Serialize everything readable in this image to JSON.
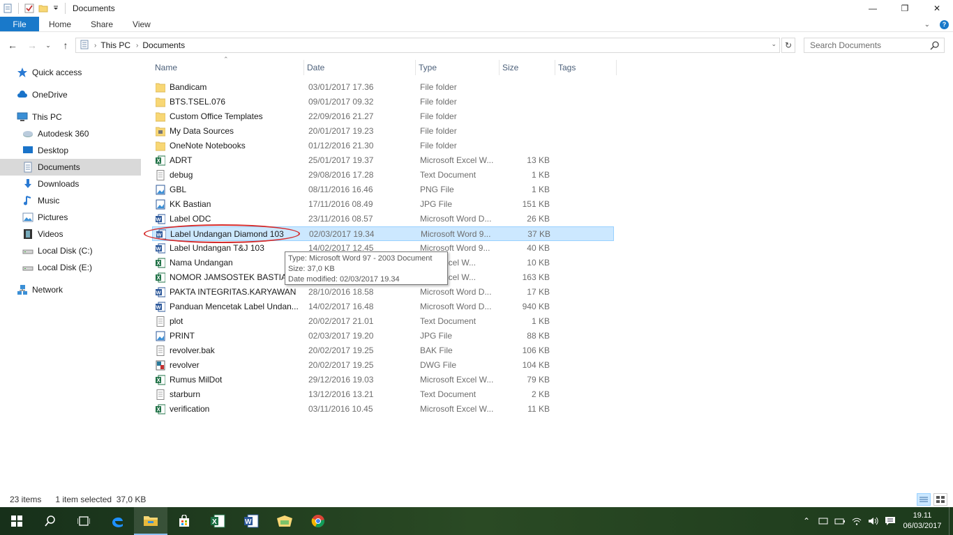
{
  "window": {
    "title": "Documents",
    "minimize": "—",
    "restore": "❐",
    "close": "✕"
  },
  "ribbon": {
    "tabs": [
      "File",
      "Home",
      "Share",
      "View"
    ]
  },
  "address": {
    "crumbs": [
      "This PC",
      "Documents"
    ],
    "search_placeholder": "Search Documents"
  },
  "nav": {
    "items": [
      {
        "label": "Quick access",
        "icon": "star-icon",
        "indent": false
      },
      {
        "label": "OneDrive",
        "icon": "cloud-icon",
        "indent": false
      },
      {
        "label": "This PC",
        "icon": "computer-icon",
        "indent": false
      },
      {
        "label": "Autodesk 360",
        "icon": "cloud-drive-icon",
        "indent": true
      },
      {
        "label": "Desktop",
        "icon": "desktop-icon",
        "indent": true
      },
      {
        "label": "Documents",
        "icon": "documents-icon",
        "indent": true,
        "selected": true
      },
      {
        "label": "Downloads",
        "icon": "download-icon",
        "indent": true
      },
      {
        "label": "Music",
        "icon": "music-icon",
        "indent": true
      },
      {
        "label": "Pictures",
        "icon": "pictures-icon",
        "indent": true
      },
      {
        "label": "Videos",
        "icon": "videos-icon",
        "indent": true
      },
      {
        "label": "Local Disk (C:)",
        "icon": "disk-icon",
        "indent": true
      },
      {
        "label": "Local Disk (E:)",
        "icon": "disk-icon",
        "indent": true
      },
      {
        "label": "Network",
        "icon": "network-icon",
        "indent": false
      }
    ]
  },
  "columns": {
    "name": "Name",
    "date": "Date",
    "type": "Type",
    "size": "Size",
    "tags": "Tags"
  },
  "files": [
    {
      "name": "Bandicam",
      "date": "03/01/2017 17.36",
      "type": "File folder",
      "size": "",
      "icon": "folder"
    },
    {
      "name": "BTS.TSEL.076",
      "date": "09/01/2017 09.32",
      "type": "File folder",
      "size": "",
      "icon": "folder"
    },
    {
      "name": "Custom Office Templates",
      "date": "22/09/2016 21.27",
      "type": "File folder",
      "size": "",
      "icon": "folder"
    },
    {
      "name": "My Data Sources",
      "date": "20/01/2017 19.23",
      "type": "File folder",
      "size": "",
      "icon": "folder-special"
    },
    {
      "name": "OneNote Notebooks",
      "date": "01/12/2016 21.30",
      "type": "File folder",
      "size": "",
      "icon": "folder"
    },
    {
      "name": "ADRT",
      "date": "25/01/2017 19.37",
      "type": "Microsoft Excel W...",
      "size": "13 KB",
      "icon": "excel"
    },
    {
      "name": "debug",
      "date": "29/08/2016 17.28",
      "type": "Text Document",
      "size": "1 KB",
      "icon": "text"
    },
    {
      "name": "GBL",
      "date": "08/11/2016 16.46",
      "type": "PNG File",
      "size": "1 KB",
      "icon": "image"
    },
    {
      "name": "KK Bastian",
      "date": "17/11/2016 08.49",
      "type": "JPG File",
      "size": "151 KB",
      "icon": "image"
    },
    {
      "name": "Label ODC",
      "date": "23/11/2016 08.57",
      "type": "Microsoft Word D...",
      "size": "26 KB",
      "icon": "word"
    },
    {
      "name": "Label Undangan Diamond 103",
      "date": "02/03/2017 19.34",
      "type": "Microsoft Word 9...",
      "size": "37 KB",
      "icon": "word",
      "selected": true
    },
    {
      "name": "Label Undangan T&J 103",
      "date": "14/02/2017 12.45",
      "type": "Microsoft Word 9...",
      "size": "40 KB",
      "icon": "word"
    },
    {
      "name": "Nama Undangan",
      "date": "",
      "type": "...oft Excel W...",
      "size": "10 KB",
      "icon": "excel"
    },
    {
      "name": "NOMOR JAMSOSTEK BASTIAN",
      "date": "",
      "type": "...oft Excel W...",
      "size": "163 KB",
      "icon": "excel"
    },
    {
      "name": "PAKTA INTEGRITAS.KARYAWAN",
      "date": "28/10/2016 18.58",
      "type": "Microsoft Word D...",
      "size": "17 KB",
      "icon": "word"
    },
    {
      "name": "Panduan Mencetak Label Undan...",
      "date": "14/02/2017 16.48",
      "type": "Microsoft Word D...",
      "size": "940 KB",
      "icon": "word"
    },
    {
      "name": "plot",
      "date": "20/02/2017 21.01",
      "type": "Text Document",
      "size": "1 KB",
      "icon": "text"
    },
    {
      "name": "PRINT",
      "date": "02/03/2017 19.20",
      "type": "JPG File",
      "size": "88 KB",
      "icon": "image"
    },
    {
      "name": "revolver.bak",
      "date": "20/02/2017 19.25",
      "type": "BAK File",
      "size": "106 KB",
      "icon": "text"
    },
    {
      "name": "revolver",
      "date": "20/02/2017 19.25",
      "type": "DWG File",
      "size": "104 KB",
      "icon": "dwg"
    },
    {
      "name": "Rumus MilDot",
      "date": "29/12/2016 19.03",
      "type": "Microsoft Excel W...",
      "size": "79 KB",
      "icon": "excel"
    },
    {
      "name": "starburn",
      "date": "13/12/2016 13.21",
      "type": "Text Document",
      "size": "2 KB",
      "icon": "text"
    },
    {
      "name": "verification",
      "date": "03/11/2016 10.45",
      "type": "Microsoft Excel W...",
      "size": "11 KB",
      "icon": "excel"
    }
  ],
  "tooltip": {
    "type": "Type: Microsoft Word 97 - 2003 Document",
    "size": "Size: 37,0 KB",
    "modified": "Date modified: 02/03/2017 19.34"
  },
  "status": {
    "count": "23 items",
    "selection": "1 item selected  37,0 KB"
  },
  "taskbar": {
    "time": "19.11",
    "date": "06/03/2017"
  },
  "colors": {
    "accent": "#1979ca",
    "selection": "#cce8ff",
    "folder": "#f8d775",
    "excel": "#1d7044",
    "word": "#2b579a",
    "oval": "#d42a2a"
  }
}
